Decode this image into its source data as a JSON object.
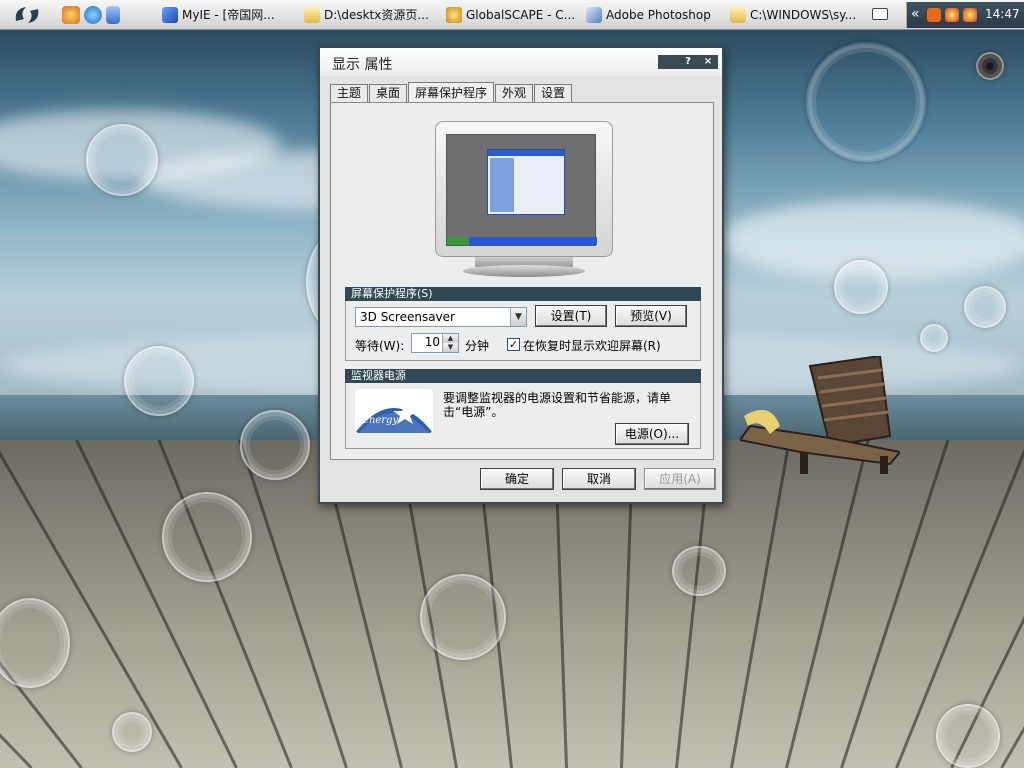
{
  "taskbar": {
    "tasks": [
      {
        "label": "MyIE - [帝国网...",
        "icon": "browser-icon"
      },
      {
        "label": "D:\\desktx资源页...",
        "icon": "folder-icon"
      },
      {
        "label": "GlobalSCAPE - C...",
        "icon": "ftp-icon"
      },
      {
        "label": "Adobe Photoshop",
        "icon": "photoshop-icon"
      },
      {
        "label": "C:\\WINDOWS\\sy...",
        "icon": "folder-icon"
      }
    ],
    "clock": "14:47"
  },
  "dialog": {
    "title": "显示 属性",
    "tabs": [
      "主题",
      "桌面",
      "屏幕保护程序",
      "外观",
      "设置"
    ],
    "active_tab": "屏幕保护程序",
    "screensaver": {
      "group_label": "屏幕保护程序(S)",
      "selected": "3D Screensaver",
      "settings_button": "设置(T)",
      "preview_button": "预览(V)",
      "wait_label": "等待(W):",
      "wait_value": "10",
      "minutes_label": "分钟",
      "resume_checkbox_label": "在恢复时显示欢迎屏幕(R)",
      "resume_checked": true
    },
    "power": {
      "group_label": "监视器电源",
      "text": "要调整监视器的电源设置和节省能源，请单击“电源”。",
      "power_button": "电源(O)...",
      "logo_text": "energy"
    },
    "buttons": {
      "ok": "确定",
      "cancel": "取消",
      "apply": "应用(A)"
    }
  }
}
